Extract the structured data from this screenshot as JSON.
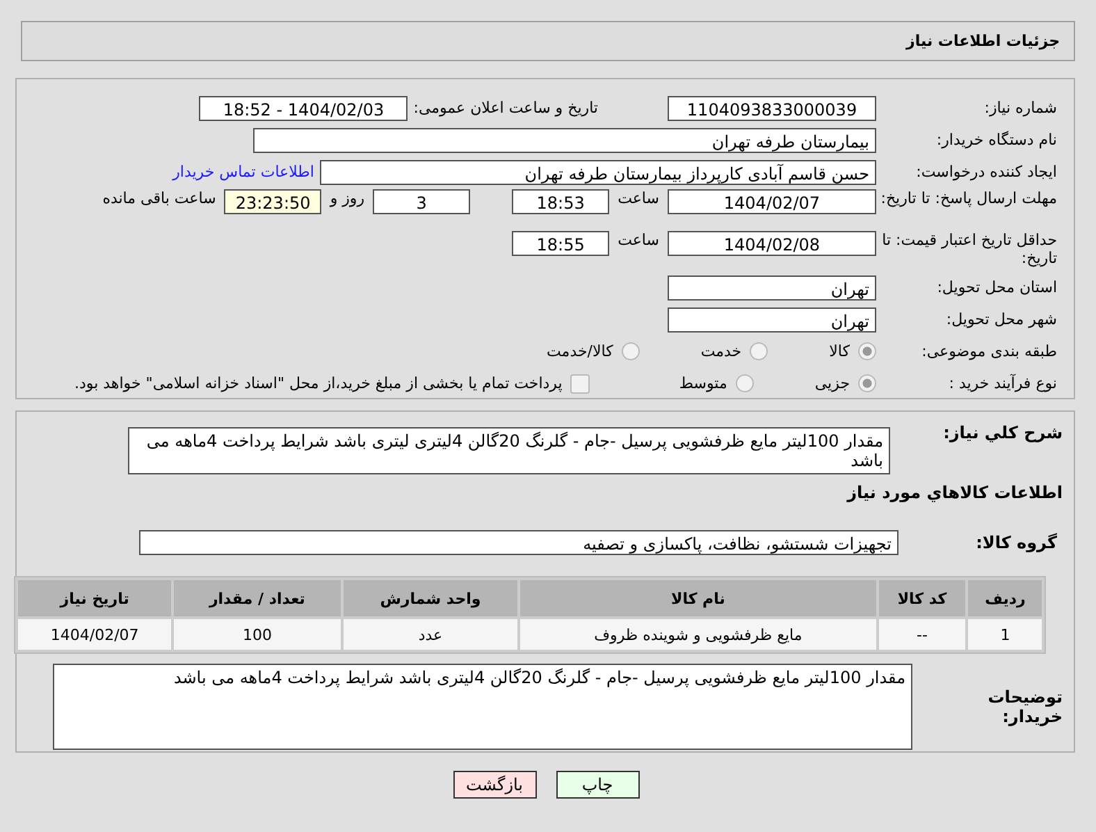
{
  "header": {
    "title": "جزئیات اطلاعات نیاز"
  },
  "form": {
    "need_number": {
      "label": "شماره نیاز:",
      "value": "1104093833000039"
    },
    "announce": {
      "label": "تاریخ و ساعت اعلان عمومی:",
      "value": "1404/02/03 - 18:52"
    },
    "buyer_org": {
      "label": "نام دستگاه خریدار:",
      "value": "بیمارستان طرفه تهران"
    },
    "creator": {
      "label": "ایجاد کننده درخواست:",
      "value": "حسن قاسم آبادی کارپرداز بیمارستان طرفه تهران",
      "link": "اطلاعات تماس خریدار"
    },
    "reply_deadline": {
      "label": "مهلت ارسال پاسخ: تا تاریخ:",
      "date": "1404/02/07",
      "time_label": "ساعت",
      "time": "18:53",
      "days": "3",
      "days_label": "روز و",
      "remaining": "23:23:50",
      "remaining_label": "ساعت باقی مانده"
    },
    "price_validity": {
      "label": "حداقل تاریخ اعتبار قیمت: تا تاریخ:",
      "date": "1404/02/08",
      "time_label": "ساعت",
      "time": "18:55"
    },
    "province": {
      "label": "استان محل تحویل:",
      "value": "تهران"
    },
    "city": {
      "label": "شهر محل تحویل:",
      "value": "تهران"
    },
    "category": {
      "label": "طبقه بندی موضوعی:",
      "options": [
        {
          "label": "کالا",
          "selected": true
        },
        {
          "label": "خدمت",
          "selected": false
        },
        {
          "label": "کالا/خدمت",
          "selected": false
        }
      ]
    },
    "process": {
      "label": "نوع فرآیند خرید :",
      "options": [
        {
          "label": "جزیی",
          "selected": true
        },
        {
          "label": "متوسط",
          "selected": false
        }
      ],
      "payment_note": {
        "label": "پرداخت تمام یا بخشی از مبلغ خرید،از محل \"اسناد خزانه اسلامی\" خواهد بود.",
        "checked": false
      }
    }
  },
  "details": {
    "description": {
      "label": "شرح کلي نياز:",
      "value": "مقدار 100لیتر مایع ظرفشویی پرسیل -جام - گلرنگ 20گالن 4لیتری لیتری باشد شرایط پرداخت 4ماهه می باشد"
    },
    "items_heading": "اطلاعات كالاهاي مورد نياز",
    "goods_group": {
      "label": "گروه کالا:",
      "value": "تجهیزات شستشو، نظافت، پاکسازی و تصفیه"
    },
    "table": {
      "columns": [
        "ردیف",
        "کد کالا",
        "نام کالا",
        "واحد شمارش",
        "تعداد / مقدار",
        "تاریخ نیاز"
      ],
      "rows": [
        [
          "1",
          "--",
          "مایع ظرفشویی و شوینده ظروف",
          "عدد",
          "100",
          "1404/02/07"
        ]
      ]
    },
    "buyer_notes": {
      "label": "توضیحات خریدار:",
      "value": "مقدار 100لیتر مایع ظرفشویی پرسیل -جام - گلرنگ 20گالن  4لیتری باشد شرایط پرداخت 4ماهه می باشد"
    }
  },
  "buttons": [
    {
      "label": "چاپ",
      "kind": "print"
    },
    {
      "label": "بازگشت",
      "kind": "back"
    }
  ]
}
